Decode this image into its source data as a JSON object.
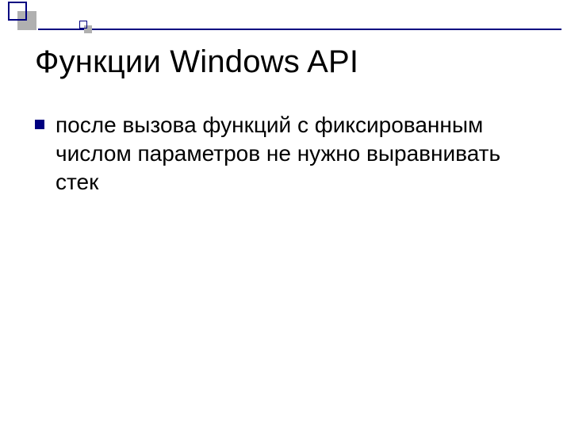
{
  "title": "Функции Windows API",
  "bullets": [
    "после вызова функций с фиксированным числом параметров не нужно выравнивать стек"
  ],
  "colors": {
    "accent": "#000080",
    "muted": "#b0b0b0"
  }
}
